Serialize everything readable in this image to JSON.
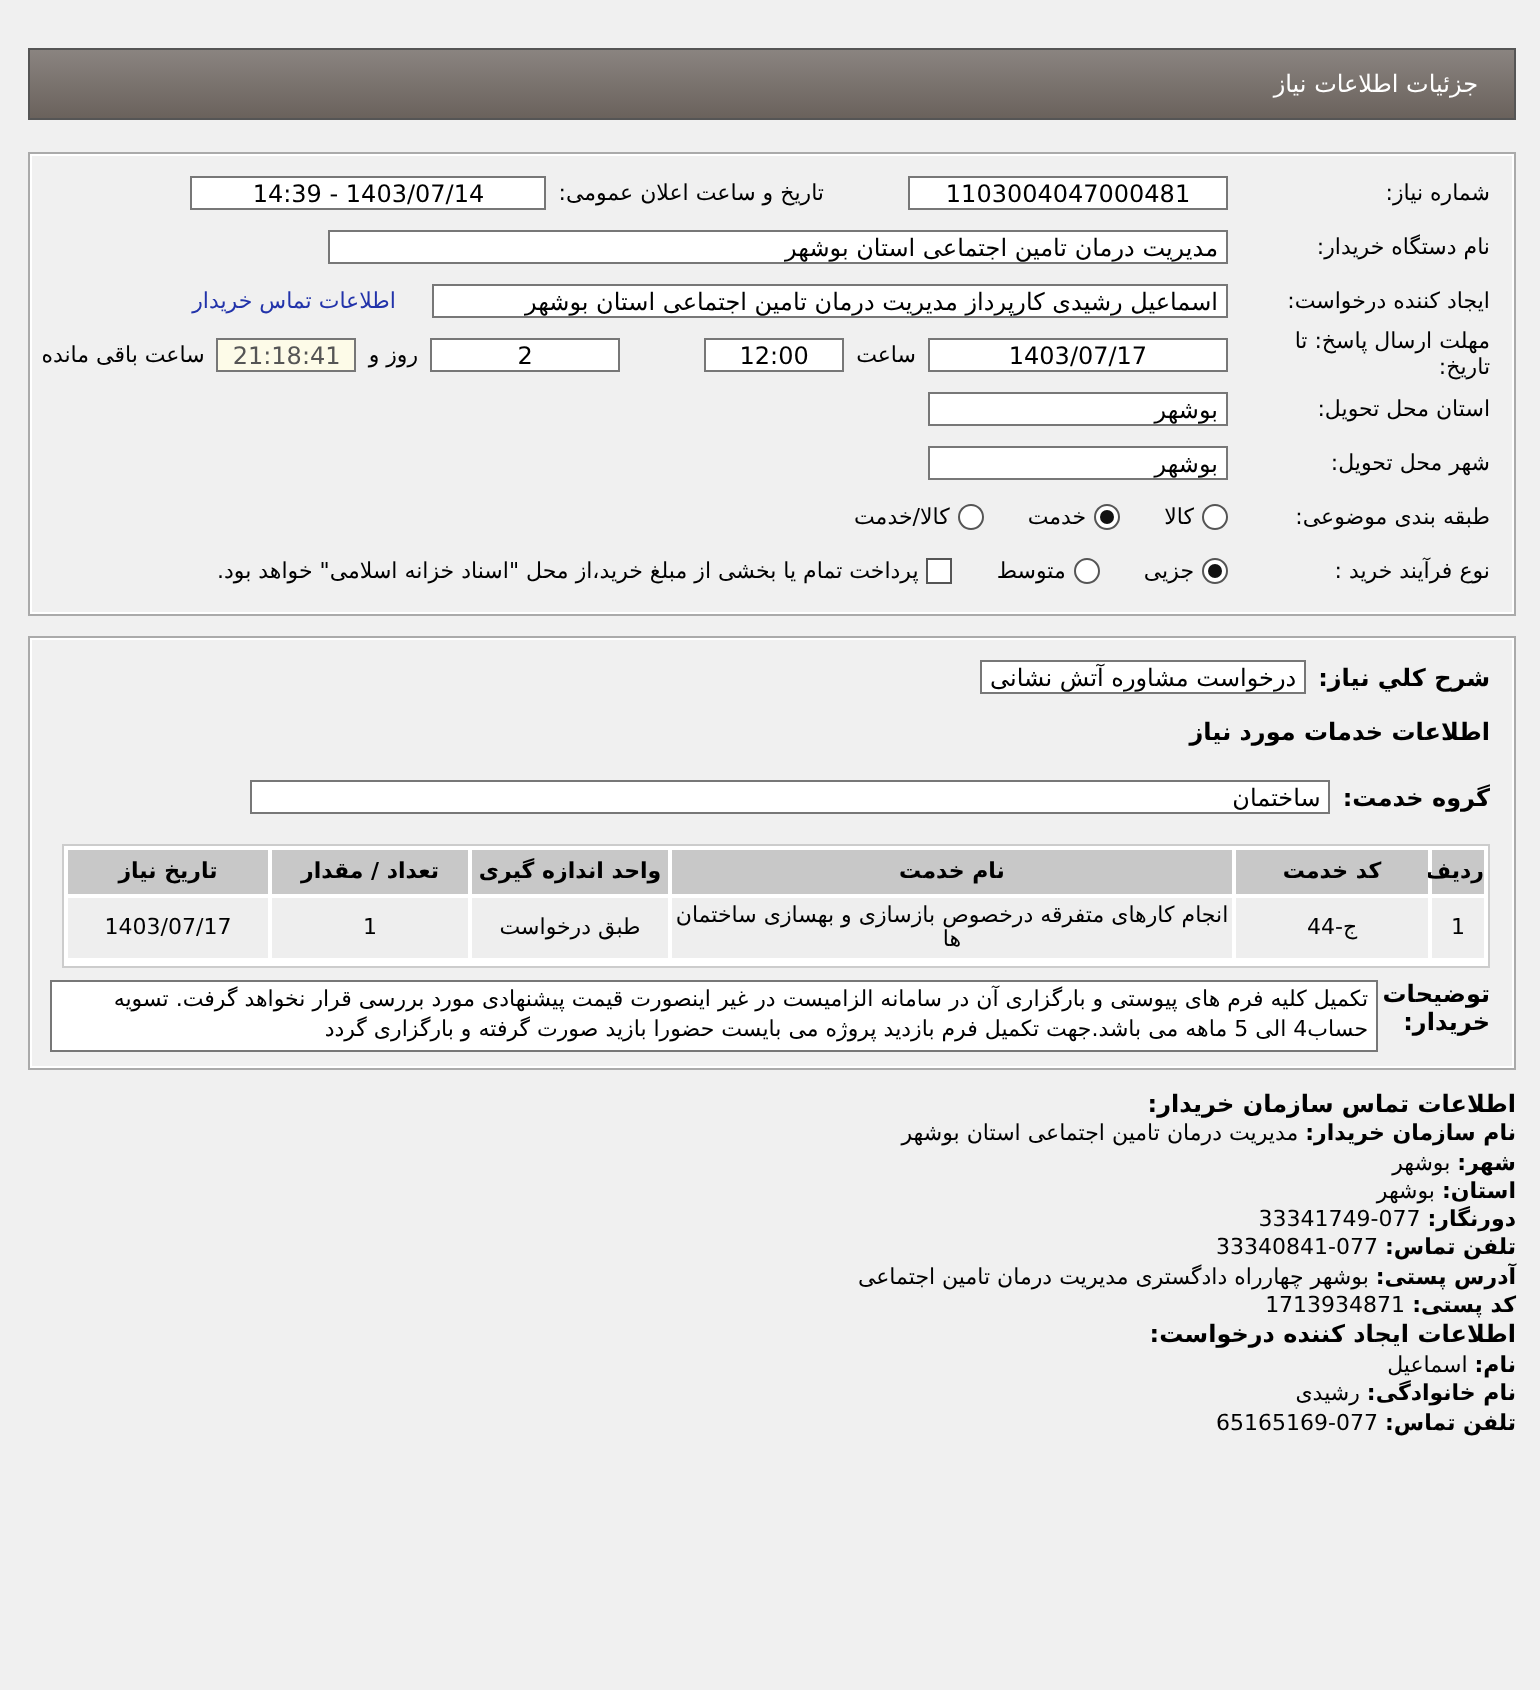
{
  "header": {
    "title": "جزئیات اطلاعات نیاز"
  },
  "details": {
    "need_number": {
      "label": "شماره نیاز:",
      "value": "1103004047000481"
    },
    "announce": {
      "label": "تاریخ و ساعت اعلان عمومی:",
      "value": "1403/07/14 - 14:39"
    },
    "buyer_org": {
      "label": "نام دستگاه خریدار:",
      "value": "مدیریت درمان تامین اجتماعی استان بوشهر"
    },
    "creator": {
      "label": "ایجاد کننده درخواست:",
      "value": "اسماعیل رشیدی کارپرداز مدیریت درمان تامین اجتماعی استان بوشهر",
      "link": "اطلاعات تماس خریدار"
    },
    "deadline": {
      "label": "مهلت ارسال پاسخ: تا تاریخ:",
      "date": "1403/07/17",
      "time_label": "ساعت",
      "time": "12:00",
      "days": "2",
      "days_label": "روز و",
      "remaining": "21:18:41",
      "remaining_label": "ساعت باقی مانده"
    },
    "province": {
      "label": "استان محل تحویل:",
      "value": "بوشهر"
    },
    "city": {
      "label": "شهر محل تحویل:",
      "value": "بوشهر"
    },
    "category": {
      "label": "طبقه بندی موضوعی:",
      "options": [
        {
          "label": "کالا",
          "selected": false
        },
        {
          "label": "خدمت",
          "selected": true
        },
        {
          "label": "کالا/خدمت",
          "selected": false
        }
      ]
    },
    "process": {
      "label": "نوع فرآیند خرید :",
      "options": [
        {
          "label": "جزیی",
          "selected": true
        },
        {
          "label": "متوسط",
          "selected": false
        }
      ],
      "payment": {
        "label": "پرداخت تمام یا بخشی از مبلغ خرید،از محل \"اسناد خزانه اسلامی\" خواهد بود.",
        "checked": false
      }
    }
  },
  "summary": {
    "label": "شرح كلي نياز:",
    "value": "درخواست مشاوره آتش نشانی"
  },
  "services_title": "اطلاعات خدمات مورد نیاز",
  "service_group": {
    "label": "گروه خدمت:",
    "value": "ساختمان"
  },
  "table": {
    "columns": [
      "ردیف",
      "کد خدمت",
      "نام خدمت",
      "واحد اندازه گیری",
      "تعداد / مقدار",
      "تاریخ نیاز"
    ],
    "rows": [
      [
        "1",
        "ج-44",
        "انجام کارهای متفرقه درخصوص بازسازی و بهسازی ساختمان ها",
        "طبق درخواست",
        "1",
        "1403/07/17"
      ]
    ]
  },
  "notes": {
    "label": "توضیحات خریدار:",
    "text": "تکمیل کلیه فرم های پیوستی و بارگزاری آن در سامانه الزامیست در غیر اینصورت قیمت پیشنهادی مورد بررسی قرار نخواهد گرفت. تسویه حساب4 الی 5 ماهه می باشد.جهت تکمیل فرم بازدید پروژه می بایست حضورا بازید صورت گرفته و بارگزاری گردد"
  },
  "contact": [
    {
      "kind": "heading",
      "text": "اطلاعات تماس سازمان خریدار:"
    },
    {
      "kind": "line",
      "text": "**نام سازمان خریدار:** مدیریت درمان تامین اجتماعی استان بوشهر"
    },
    {
      "kind": "line",
      "text": "**شهر:** بوشهر"
    },
    {
      "kind": "line",
      "text": "**استان:** بوشهر"
    },
    {
      "kind": "line",
      "text": "**دورنگار:** 077-33341749"
    },
    {
      "kind": "line",
      "text": "**تلفن تماس:** 077-33340841"
    },
    {
      "kind": "line",
      "text": "**آدرس پستی:** بوشهر چهارراه دادگستری مدیریت درمان تامین اجتماعی"
    },
    {
      "kind": "line",
      "text": "**کد پستی:** 1713934871"
    },
    {
      "kind": "heading",
      "text": "اطلاعات ایجاد کننده درخواست:"
    },
    {
      "kind": "line",
      "text": "**نام:** اسماعیل"
    },
    {
      "kind": "line",
      "text": "**نام خانوادگی:** رشیدی"
    },
    {
      "kind": "line",
      "text": "**تلفن تماس:** 077-65165169"
    }
  ]
}
